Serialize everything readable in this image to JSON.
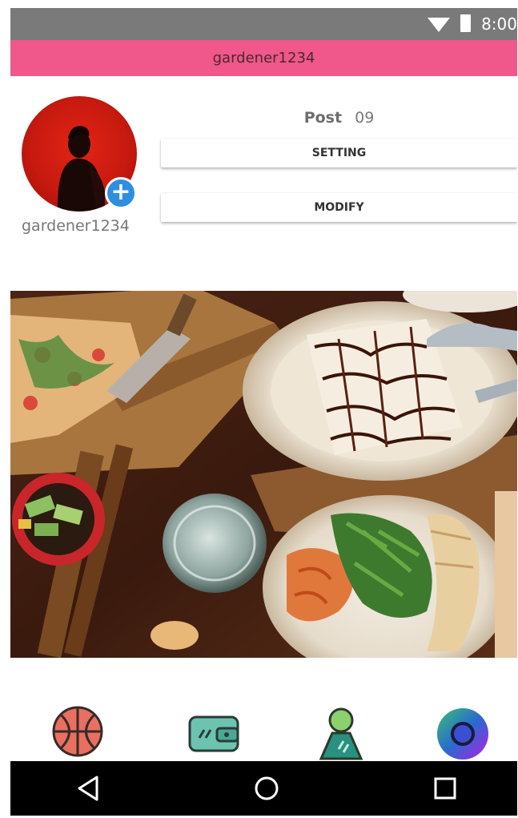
{
  "status_bar": {
    "time": "8:00"
  },
  "title_bar": {
    "username": "gardener1234"
  },
  "profile": {
    "username": "gardener1234",
    "post_label": "Post",
    "post_count": "09",
    "setting_label": "SETTING",
    "modify_label": "MODIFY"
  },
  "colors": {
    "accent_pink": "#f0578a",
    "status_bar_gray": "#7a7a7a",
    "avatar_red": "#d01e12",
    "add_button_blue": "#2e8fe0"
  },
  "bottom_nav": [
    {
      "name": "basketball-icon"
    },
    {
      "name": "wallet-icon"
    },
    {
      "name": "person-icon"
    },
    {
      "name": "camera-lens-icon"
    }
  ],
  "system_nav": [
    "back-icon",
    "home-icon",
    "recents-icon"
  ]
}
